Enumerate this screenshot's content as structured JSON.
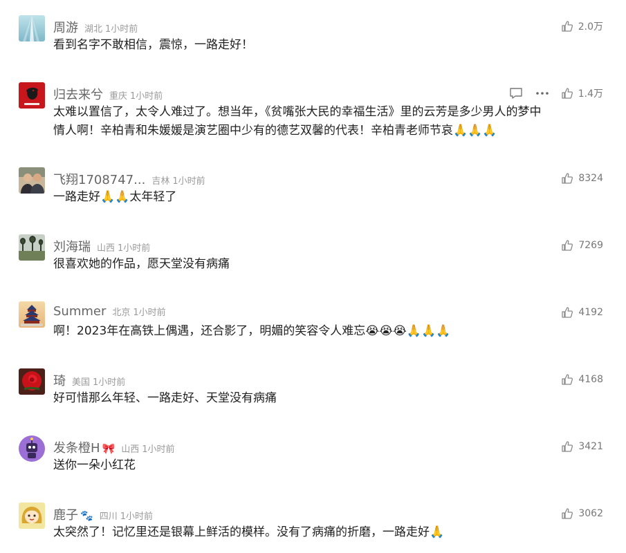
{
  "comments": [
    {
      "name": "周游",
      "badge": "",
      "location": "湖北",
      "time": "1小时前",
      "lines": [
        "看到名字不敢相信，震惊，一路走好！"
      ],
      "likes": "2.0万",
      "avatar": "light-blue-ray-avatar"
    },
    {
      "name": "归去来兮",
      "badge": "",
      "location": "重庆",
      "time": "1小时前",
      "lines": [
        "太难以置信了，太令人难过了。想当年，《贫嘴张大民的幸福生活》里的云芳是多少男人的梦中",
        "情人啊！辛柏青和朱媛媛是演艺圈中少有的德艺双馨的代表！辛柏青老师节哀🙏🙏🙏"
      ],
      "likes": "1.4万",
      "avatar": "red-portrait-avatar",
      "show_actions": true
    },
    {
      "name": "飞翔1708747...",
      "badge": "",
      "location": "吉林",
      "time": "1小时前",
      "lines": [
        "一路走好🙏🙏太年轻了"
      ],
      "likes": "8324",
      "avatar": "group-photo-avatar"
    },
    {
      "name": "刘海瑞",
      "badge": "",
      "location": "山西",
      "time": "1小时前",
      "lines": [
        "很喜欢她的作品，愿天堂没有病痛"
      ],
      "likes": "7269",
      "avatar": "landscape-trees-avatar"
    },
    {
      "name": "Summer",
      "badge": "",
      "location": "北京",
      "time": "1小时前",
      "lines": [
        "啊！2023年在高铁上偶遇，还合影了，明媚的笑容令人难忘😭😭😭🙏🙏🙏"
      ],
      "likes": "4192",
      "avatar": "temple-of-heaven-avatar"
    },
    {
      "name": "琦",
      "badge": "",
      "location": "美国",
      "time": "1小时前",
      "lines": [
        "好可惜那么年轻、一路走好、天堂没有病痛"
      ],
      "likes": "4168",
      "avatar": "red-rose-avatar"
    },
    {
      "name": "发条橙H",
      "badge": "🎀",
      "location": "山西",
      "time": "1小时前",
      "lines": [
        "送你一朵小红花"
      ],
      "likes": "3421",
      "avatar": "purple-robot-avatar"
    },
    {
      "name": "鹿子",
      "badge": "🐾",
      "location": "四川",
      "time": "1小时前",
      "lines": [
        "太突然了！记忆里还是银幕上鲜活的模样。没有了病痛的折磨，一路走好🙏"
      ],
      "likes": "3062",
      "avatar": "cartoon-girl-avatar"
    }
  ]
}
